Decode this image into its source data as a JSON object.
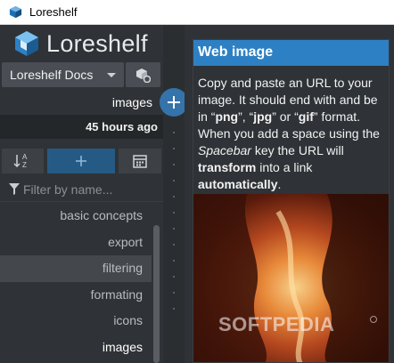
{
  "window": {
    "title": "Loreshelf"
  },
  "brand": {
    "name": "Loreshelf",
    "color": "#2d80c3"
  },
  "document_selector": {
    "value": "Loreshelf Docs"
  },
  "current_page": {
    "name": "images",
    "modified": "45 hours ago"
  },
  "toolbar": {
    "icons": [
      "sort-alpha-icon",
      "plus-icon",
      "calendar-icon"
    ]
  },
  "filter": {
    "placeholder": "Filter by name..."
  },
  "pages": [
    {
      "label": "basic concepts"
    },
    {
      "label": "export"
    },
    {
      "label": "filtering"
    },
    {
      "label": "formating"
    },
    {
      "label": "icons"
    },
    {
      "label": "images"
    }
  ],
  "help_card": {
    "title": "Web image",
    "p1": "Copy and paste an URL to your image. It should end with and be in “",
    "png": "png",
    "sep1": "”, “",
    "jpg": "jpg",
    "sep2": "” or “",
    "gif": "gif",
    "p2": "” format. When you add a space using the ",
    "spacebar": "Spacebar",
    "p3": " key the URL will ",
    "transform": "transform",
    "p4": " into a link ",
    "automatically": "automatically",
    "p5": "."
  },
  "watermark": {
    "text": "SOFTPEDIA"
  }
}
